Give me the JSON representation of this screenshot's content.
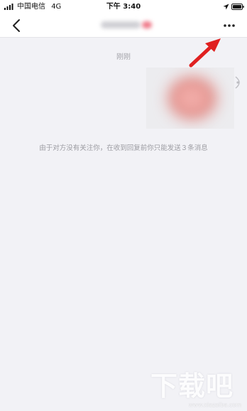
{
  "status_bar": {
    "carrier": "中国电信",
    "network": "4G",
    "time": "下午 3:40",
    "icons": [
      "signal-bars-icon",
      "location-arrow-icon",
      "battery-icon"
    ]
  },
  "nav_bar": {
    "back_icon": "chevron-left-icon",
    "contact_name": "",
    "more_icon": "more-dots-icon"
  },
  "chat": {
    "timestamp": "刚刚",
    "system_notice": "由于对方没有关注你，在收到回复前你只能发送３条消息"
  },
  "watermark": {
    "text": "下载吧",
    "url": "www.xiazaiba.com"
  },
  "colors": {
    "annotation_arrow": "#e02020",
    "background": "#f2f2f6",
    "bar": "#ffffff"
  }
}
